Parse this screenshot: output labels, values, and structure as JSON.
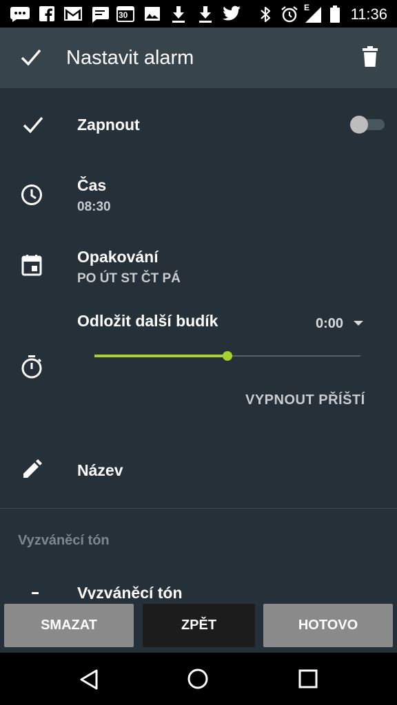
{
  "status_bar": {
    "time": "11:36",
    "calendar_day": "30",
    "network_type": "E"
  },
  "app_bar": {
    "title": "Nastavit alarm"
  },
  "enable": {
    "label": "Zapnout",
    "on": false
  },
  "time": {
    "label": "Čas",
    "value": "08:30"
  },
  "repeat": {
    "label": "Opakování",
    "days": "PO ÚT ST ČT PÁ"
  },
  "snooze": {
    "label": "Odložit další budík",
    "value": "0:00",
    "slider_fraction": 0.5,
    "skip_next_label": "VYPNOUT PŘÍŠTÍ"
  },
  "name": {
    "label": "Název"
  },
  "ringtone_section": {
    "header": "Vyzváněcí tón",
    "item_label": "Vyzváněcí tón"
  },
  "buttons": {
    "delete": "SMAZAT",
    "back": "ZPĚT",
    "done": "HOTOVO"
  },
  "colors": {
    "accent": "#a6d32b",
    "background": "#263039",
    "app_bar": "#37444c"
  }
}
